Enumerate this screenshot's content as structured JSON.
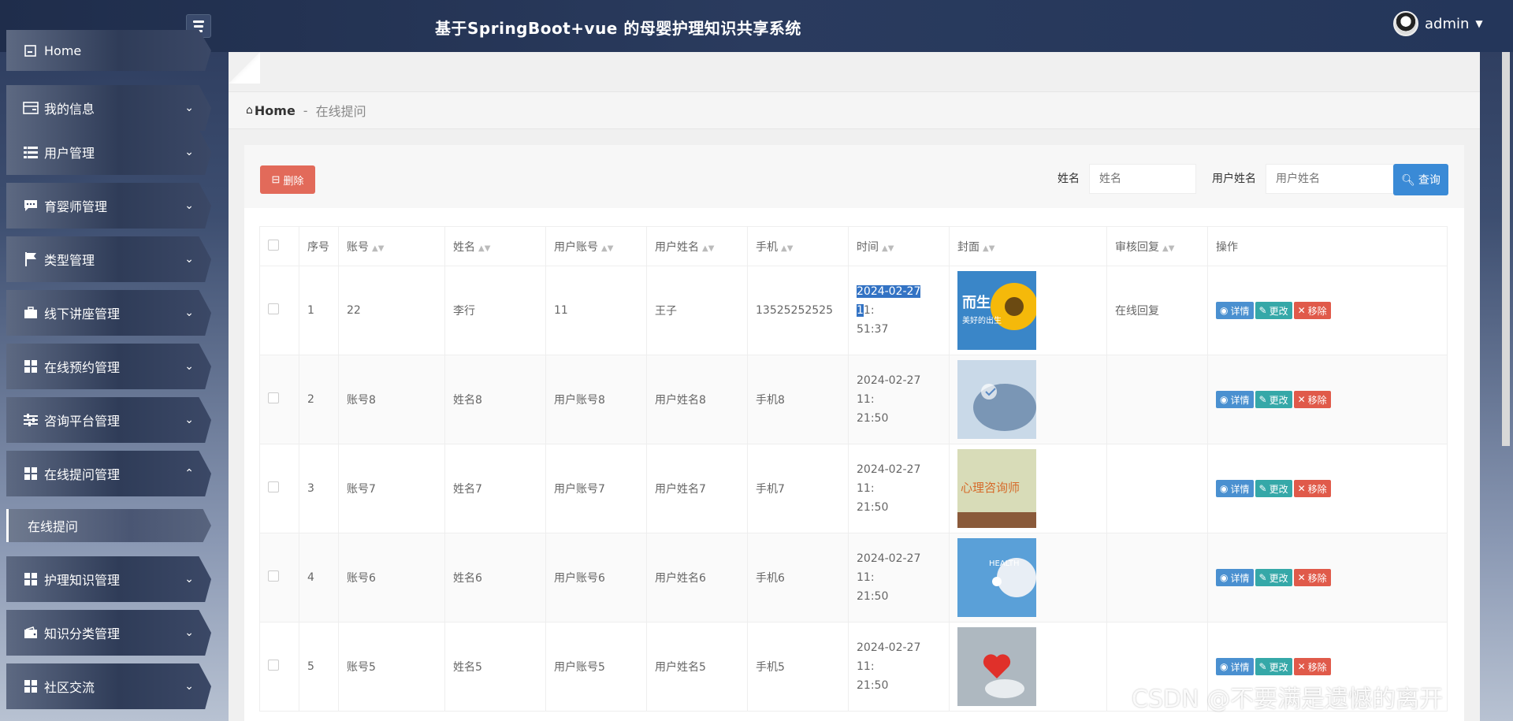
{
  "header": {
    "title": "基于SpringBoot+vue 的母婴护理知识共享系统",
    "user": "admin"
  },
  "sidebar": {
    "home": "Home",
    "items": [
      {
        "label": "我的信息",
        "icon": "id-card-icon"
      },
      {
        "label": "用户管理",
        "icon": "list-icon"
      },
      {
        "label": "育婴师管理",
        "icon": "chat-icon"
      },
      {
        "label": "类型管理",
        "icon": "flag-icon"
      },
      {
        "label": "线下讲座管理",
        "icon": "briefcase-icon"
      },
      {
        "label": "在线预约管理",
        "icon": "grid-icon"
      },
      {
        "label": "咨询平台管理",
        "icon": "sliders-icon"
      },
      {
        "label": "在线提问管理",
        "icon": "grid-icon"
      },
      {
        "label": "护理知识管理",
        "icon": "grid-icon"
      },
      {
        "label": "知识分类管理",
        "icon": "wallet-icon"
      },
      {
        "label": "社区交流",
        "icon": "grid-icon"
      }
    ],
    "active_sub": "在线提问"
  },
  "breadcrumb": {
    "home": "Home",
    "sep": "-",
    "current": "在线提问"
  },
  "toolbar": {
    "delete_label": "删除",
    "name_label": "姓名",
    "name_placeholder": "姓名",
    "username_label": "用户姓名",
    "username_placeholder": "用户姓名",
    "query_label": "查询"
  },
  "table": {
    "columns": [
      "序号",
      "账号",
      "姓名",
      "用户账号",
      "用户姓名",
      "手机",
      "时间",
      "封面",
      "审核回复",
      "操作"
    ],
    "actions": {
      "detail": "详情",
      "edit": "更改",
      "remove": "移除"
    },
    "rows": [
      {
        "idx": "1",
        "account": "22",
        "name": "李行",
        "user_account": "11",
        "user_name": "王子",
        "phone": "13525252525",
        "time_a": "2024-02-27 1",
        "time_b": "1:",
        "time_c": "51:37",
        "reply": "在线回复",
        "cover": "sunflower"
      },
      {
        "idx": "2",
        "account": "账号8",
        "name": "姓名8",
        "user_account": "用户账号8",
        "user_name": "用户姓名8",
        "phone": "手机8",
        "time_a": "2024-02-27 11:",
        "time_b": "",
        "time_c": "21:50",
        "reply": "",
        "cover": "medical"
      },
      {
        "idx": "3",
        "account": "账号7",
        "name": "姓名7",
        "user_account": "用户账号7",
        "user_name": "用户姓名7",
        "phone": "手机7",
        "time_a": "2024-02-27 11:",
        "time_b": "",
        "time_c": "21:50",
        "reply": "",
        "cover": "book"
      },
      {
        "idx": "4",
        "account": "账号6",
        "name": "姓名6",
        "user_account": "用户账号6",
        "user_name": "用户姓名6",
        "phone": "手机6",
        "time_a": "2024-02-27 11:",
        "time_b": "",
        "time_c": "21:50",
        "reply": "",
        "cover": "health"
      },
      {
        "idx": "5",
        "account": "账号5",
        "name": "姓名5",
        "user_account": "用户账号5",
        "user_name": "用户姓名5",
        "phone": "手机5",
        "time_a": "2024-02-27 11:",
        "time_b": "",
        "time_c": "21:50",
        "reply": "",
        "cover": "heart"
      }
    ]
  },
  "cover_texts": {
    "sunflower_a": "而生",
    "sunflower_b": "美好的出生",
    "book": "心理咨询师",
    "health": "HEALTH"
  },
  "watermark": "CSDN @不要满是遗憾的离开",
  "colors": {
    "danger": "#e26a5a",
    "primary": "#3a8ad6",
    "teal": "#35a8a8"
  }
}
